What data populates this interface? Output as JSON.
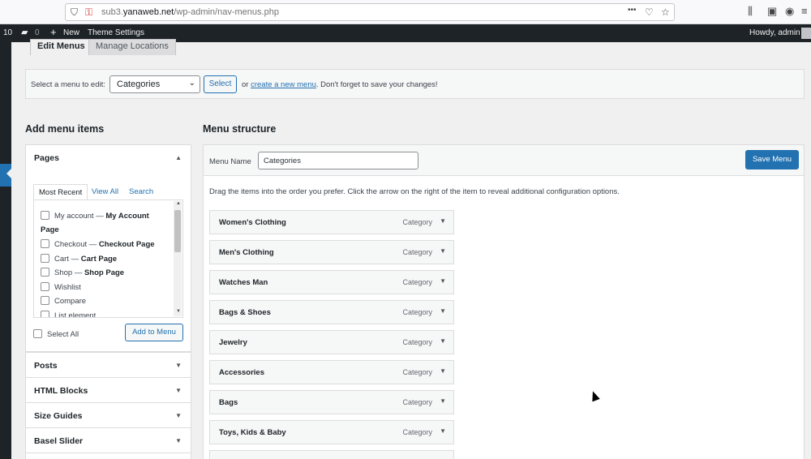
{
  "browser": {
    "url_prefix": "sub3.",
    "url_domain": "yanaweb.net",
    "url_path": "/wp-admin/nav-menus.php",
    "more_label": "•••"
  },
  "adminbar": {
    "site_num": "10",
    "comments": "0",
    "new_label": "New",
    "theme_settings": "Theme Settings",
    "howdy": "Howdy, admin"
  },
  "tabs": [
    {
      "label": "Edit Menus"
    },
    {
      "label": "Manage Locations"
    }
  ],
  "manage": {
    "label": "Select a menu to edit:",
    "selected": "Categories",
    "select_button": "Select",
    "or_text": "or",
    "create_link": "create a new menu",
    "tail_text": ". Don't forget to save your changes!"
  },
  "left": {
    "title": "Add menu items",
    "pages_title": "Pages",
    "inner_tabs": [
      "Most Recent",
      "View All",
      "Search"
    ],
    "items": [
      {
        "label": "My account — ",
        "bold": "My Account",
        "extra": "Page"
      },
      {
        "label": "Checkout — ",
        "bold": "Checkout Page"
      },
      {
        "label": "Cart — ",
        "bold": "Cart Page"
      },
      {
        "label": "Shop — ",
        "bold": "Shop Page"
      },
      {
        "label": "Wishlist",
        "bold": ""
      },
      {
        "label": "Compare",
        "bold": ""
      },
      {
        "label": "List element",
        "bold": ""
      }
    ],
    "select_all": "Select All",
    "add_button": "Add to Menu",
    "collapsed": [
      "Posts",
      "HTML Blocks",
      "Size Guides",
      "Basel Slider"
    ]
  },
  "right": {
    "title": "Menu structure",
    "menu_name_label": "Menu Name",
    "menu_name_value": "Categories",
    "save_button": "Save Menu",
    "instructions": "Drag the items into the order you prefer. Click the arrow on the right of the item to reveal additional configuration options.",
    "item_type": "Category",
    "items": [
      "Women's Clothing",
      "Men's Clothing",
      "Watches Man",
      "Bags & Shoes",
      "Jewelry",
      "Accessories",
      "Bags",
      "Toys, Kids & Baby",
      ""
    ]
  },
  "colors": {
    "primary": "#2271b1",
    "adminbar": "#1d2327"
  }
}
